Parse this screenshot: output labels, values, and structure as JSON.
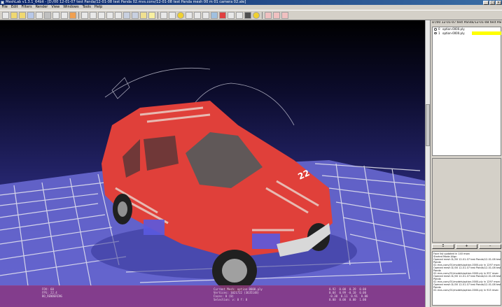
{
  "window": {
    "title": "MeshLab v1.3.1_64bit - [D:/00 12-01-07 test Panda/12-01-08 test Panda 02.mvs.conv/12-01-08 test Panda mesh 00 m 01 camera 02.ale]",
    "controls": [
      "_",
      "□",
      "×"
    ]
  },
  "menu": [
    "File",
    "Edit",
    "Filters",
    "Render",
    "View",
    "Windows",
    "Tools",
    "Help"
  ],
  "sidebar": {
    "project_title": "D:/00 12-01-07 test Panda/12-01-08 test Panda 0...",
    "layers": [
      {
        "index": "0",
        "name": "option-0000.ply",
        "selected": false
      },
      {
        "index": "1",
        "name": "option-0000.ply",
        "selected": true
      }
    ],
    "buttons": [
      "Ξ",
      "+",
      "–"
    ],
    "log": [
      "Face list updated in 140 msec",
      "Started Mode Align",
      "Opened mesh D:/00 12-01-07 test Panda/12-01-08 test",
      "Panda",
      "02.mvs.conv/01/models/option-0000.ply in 1297 msec",
      "Opened mesh D:/00 12-01-07 test Panda/12-01-08 test",
      "Panda",
      "02.mvs.conv/01/models/option-0000.ply in 937 msec",
      "Opened mesh D:/00 12-01-07 test Panda/12-01-08 test",
      "Panda",
      "02.mvs.conv/01/models/option-0000.ply in 1297 msec",
      "Opened mesh D:/00 12-01-07 test Panda/12-01-08 test",
      "Panda",
      "02.mvs.conv/01/models/option-0000.ply in 915 msec"
    ]
  },
  "viewport": {
    "info_left": "FOV: 60\nFPS: 22.4\nBO_RENDERING",
    "info_center": "Current Mesh: option-0000.ply\nVertices: 1021722 (3635148)\nFaces: 0 (0)\nSelection: v: 0 f: 0",
    "info_right": "0.92  0.00  0.39  0.00\n0.04  0.99 -0.10  0.00\n-0.38  0.11  0.91  0.00\n0.00  0.00  0.00  1.00",
    "car_number": "22",
    "colors": {
      "car_body": "#e0403a",
      "car_stripe": "#e8c8c0",
      "ground": "#6a6ad8"
    }
  }
}
